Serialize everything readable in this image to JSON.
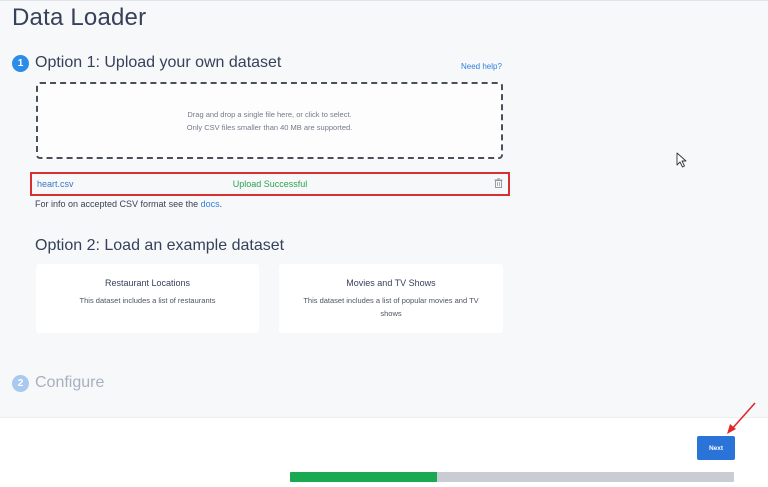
{
  "page": {
    "title": "Data Loader"
  },
  "option1": {
    "step_number": "1",
    "title": "Option 1: Upload your own dataset",
    "help_link": "Need help?",
    "dropzone": {
      "line1": "Drag and drop a single file here, or click to select.",
      "line2": "Only CSV files smaller than 40 MB are supported."
    },
    "file": {
      "name": "heart.csv",
      "status": "Upload Successful",
      "status_color": "#2ca24e"
    },
    "format_info": {
      "prefix": "For info on accepted CSV format see the",
      "link": "docs",
      "suffix": "."
    }
  },
  "option2": {
    "title": "Option 2: Load an example dataset",
    "cards": [
      {
        "title": "Restaurant Locations",
        "description": "This dataset includes a list of restaurants"
      },
      {
        "title": "Movies and TV Shows",
        "description": "This dataset includes a list of popular movies and TV shows"
      }
    ]
  },
  "configure": {
    "step_number": "2",
    "title": "Configure"
  },
  "footer": {
    "next_label": "Next",
    "progress_fraction": 0.33
  },
  "colors": {
    "accent": "#2a73d8",
    "success": "#19a950",
    "highlight_border": "#d63032"
  }
}
